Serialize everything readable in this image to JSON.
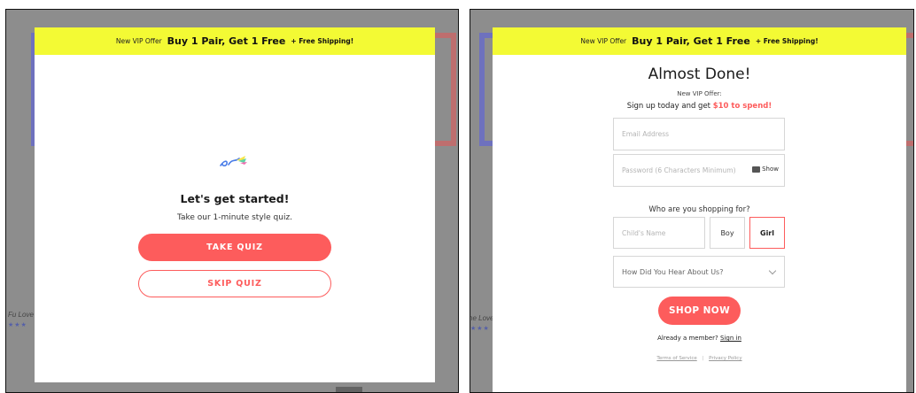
{
  "banner": {
    "prefix": "New VIP Offer",
    "offer": "Buy 1 Pair, Get 1 Free",
    "shipping": "+ Free Shipping!"
  },
  "background": {
    "left_text": "Fu Love",
    "right_text": "ne Love",
    "stars": "★★★"
  },
  "quiz_modal": {
    "logo_icon": "pencil-swoosh-logo",
    "title": "Let's get started!",
    "subtitle": "Take our 1-minute style quiz.",
    "take_quiz": "TAKE QUIZ",
    "skip_quiz": "SKIP QUIZ"
  },
  "signup_modal": {
    "title": "Almost Done!",
    "vip_label": "New VIP Offer:",
    "signup_text": "Sign up today and get",
    "signup_highlight": "$10 to spend!",
    "email_placeholder": "Email Address",
    "password_placeholder": "Password (6 Characters Minimum)",
    "show_label": "Show",
    "who_question": "Who are you shopping for?",
    "child_placeholder": "Child's Name",
    "boy_label": "Boy",
    "girl_label": "Girl",
    "hear_select": "How Did You Hear About Us?",
    "shop_now": "SHOP NOW",
    "member_text": "Already a member?",
    "sign_in": "Sign in",
    "terms": "Terms of Service",
    "privacy": "Privacy Policy"
  },
  "colors": {
    "accent": "#fd5c5c",
    "banner": "#f3fa34"
  }
}
